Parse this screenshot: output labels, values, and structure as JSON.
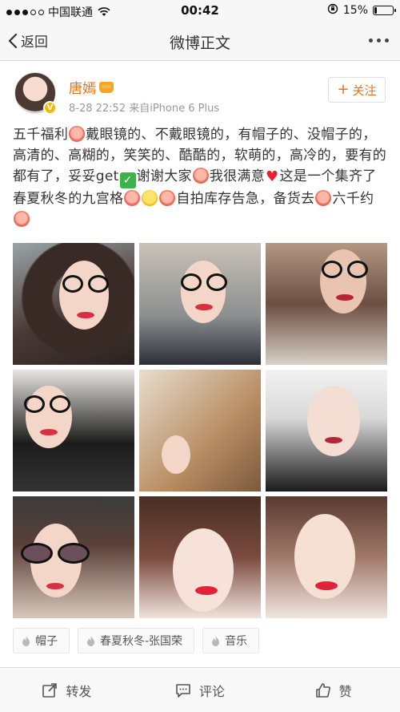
{
  "status_bar": {
    "carrier": "中国联通",
    "time": "00:42",
    "battery_percent": "15%",
    "battery_level": 0.15
  },
  "nav": {
    "back_label": "返回",
    "title": "微博正文"
  },
  "author": {
    "name": "唐嫣",
    "meta": "8-28 22:52  来自iPhone 6 Plus",
    "follow_label": "关注",
    "verified_badge": "V"
  },
  "post": {
    "seg1": "五千福利",
    "seg2": "戴眼镜的、不戴眼镜的，有帽子的、没帽子的，高清的、高糊的，笑笑的、酷酷的，软萌的，高冷的，要有的都有了，妥妥get",
    "seg3": "谢谢大家",
    "seg4": "我很满意",
    "seg5": "这是一个集齐了春夏秋冬的九宫格",
    "seg6": "自拍库存告急，备货去",
    "seg7": "六千约"
  },
  "photos": [
    {
      "label": "photo-1"
    },
    {
      "label": "photo-2"
    },
    {
      "label": "photo-3"
    },
    {
      "label": "photo-4"
    },
    {
      "label": "photo-5"
    },
    {
      "label": "photo-6"
    },
    {
      "label": "photo-7"
    },
    {
      "label": "photo-8"
    },
    {
      "label": "photo-9"
    }
  ],
  "tags": [
    "帽子",
    "春夏秋冬-张国荣",
    "音乐"
  ],
  "actions": {
    "repost": "转发",
    "comment": "评论",
    "like": "赞"
  },
  "colors": {
    "accent": "#e8731a",
    "heart": "#e8222d"
  }
}
